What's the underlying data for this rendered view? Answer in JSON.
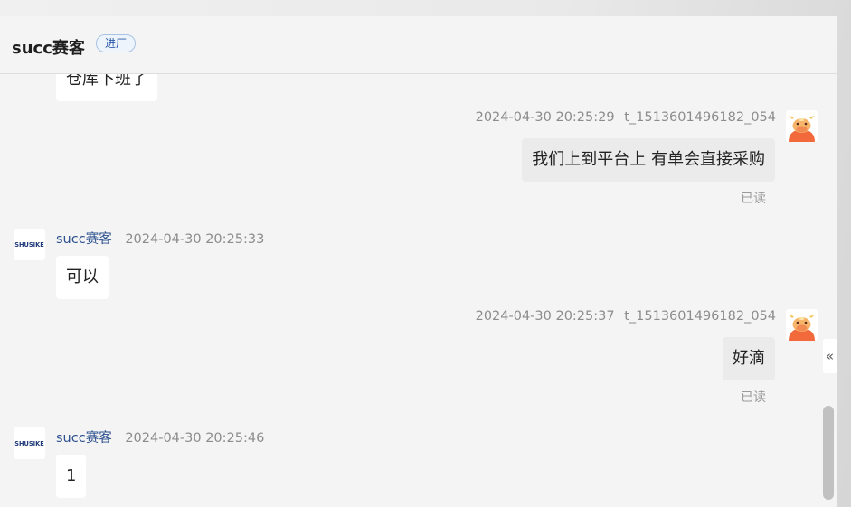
{
  "header": {
    "title": "succ赛客",
    "tag": "进厂"
  },
  "messages": [
    {
      "side": "left",
      "text": "仓库下班了"
    },
    {
      "side": "right",
      "time": "2024-04-30 20:25:29",
      "user": "t_1513601496182_054",
      "text": "我们上到平台上 有单会直接采购",
      "status": "已读"
    },
    {
      "side": "left",
      "name": "succ赛客",
      "time": "2024-04-30 20:25:33",
      "text": "可以"
    },
    {
      "side": "right",
      "time": "2024-04-30 20:25:37",
      "user": "t_1513601496182_054",
      "text": "好滴",
      "status": "已读"
    },
    {
      "side": "left",
      "name": "succ赛客",
      "time": "2024-04-30 20:25:46",
      "text": "1"
    }
  ],
  "brand_avatar": {
    "text": "SHUSIKE",
    "color": "#1f3a7a"
  },
  "collapse_icon": "«"
}
